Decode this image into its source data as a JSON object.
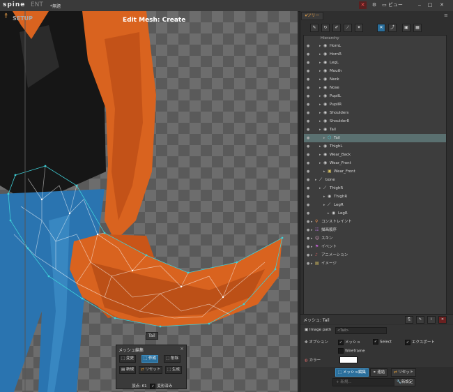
{
  "topbar": {
    "logo": "spine",
    "edition": "ENT",
    "file_name": "*無題",
    "view_menu": "ビュー"
  },
  "viewport": {
    "mode_label": "SETUP",
    "title": "Edit Mesh: Create",
    "attachment_label": "Tail"
  },
  "mesh_tools": {
    "title": "メッシュ編集",
    "buttons": {
      "modify": "変更",
      "create": "作成",
      "delete": "削除",
      "new": "新規",
      "reset": "リセット",
      "generate": "生成"
    },
    "vertices_label": "頂点: 61",
    "deformed_label": "変形済み"
  },
  "tree_panel": {
    "tab_label": "ツリー",
    "hierarchy_label": "Hierarchy",
    "items": [
      {
        "label": "HornL",
        "type": "slot",
        "depth": 3
      },
      {
        "label": "HornR",
        "type": "slot",
        "depth": 3
      },
      {
        "label": "LegL",
        "type": "slot",
        "depth": 3
      },
      {
        "label": "Mouth",
        "type": "slot",
        "depth": 3
      },
      {
        "label": "Neck",
        "type": "slot",
        "depth": 3
      },
      {
        "label": "Nose",
        "type": "slot",
        "depth": 3
      },
      {
        "label": "PupilL",
        "type": "slot",
        "depth": 3
      },
      {
        "label": "PupilR",
        "type": "slot",
        "depth": 3
      },
      {
        "label": "Shoulders",
        "type": "slot",
        "depth": 3
      },
      {
        "label": "ShoulderR",
        "type": "slot",
        "depth": 3
      },
      {
        "label": "Tail",
        "type": "slot",
        "depth": 3
      },
      {
        "label": "Tail",
        "type": "mesh",
        "depth": 4,
        "selected": true
      },
      {
        "label": "ThighL",
        "type": "slot",
        "depth": 3
      },
      {
        "label": "Wear_Back",
        "type": "slot",
        "depth": 3
      },
      {
        "label": "Wear_Front",
        "type": "slot",
        "depth": 3
      },
      {
        "label": "Wear_Front",
        "type": "image",
        "depth": 4
      },
      {
        "label": "bone",
        "type": "bone",
        "depth": 2
      },
      {
        "label": "ThighR",
        "type": "bone",
        "depth": 3
      },
      {
        "label": "ThighR",
        "type": "slot",
        "depth": 4
      },
      {
        "label": "LegR",
        "type": "bone",
        "depth": 4
      },
      {
        "label": "LegR",
        "type": "slot",
        "depth": 5
      },
      {
        "label": "コンストレイント",
        "type": "constraint",
        "depth": 1
      },
      {
        "label": "描画順序",
        "type": "draworder",
        "depth": 1
      },
      {
        "label": "スキン",
        "type": "skin",
        "depth": 1
      },
      {
        "label": "イベント",
        "type": "event",
        "depth": 1
      },
      {
        "label": "アニメーション",
        "type": "animation",
        "depth": 1
      },
      {
        "label": "イメージ",
        "type": "images",
        "depth": 1
      }
    ]
  },
  "mesh_panel": {
    "title": "メッシュ: Tail",
    "image_path_label": "Image path",
    "image_path_value": "<Tail>",
    "options_label": "オプション",
    "opt_mesh": "メッシュ",
    "opt_select": "Select",
    "opt_export": "エクスポート",
    "opt_wireframe": "Wireframe",
    "color_label": "カラー",
    "color_value": "#ffffff"
  },
  "bottom": {
    "edit_mesh": "メッシュ編集",
    "link": "連結",
    "reset": "リセット",
    "search_placeholder": "新規...",
    "new_setting": "新設定"
  },
  "colors": {
    "accent": "#2a6f9c",
    "mesh": "#3fd0d8",
    "fur": "#d9631f",
    "jeans": "#2a74b0",
    "jacket": "#1a1a1a"
  }
}
